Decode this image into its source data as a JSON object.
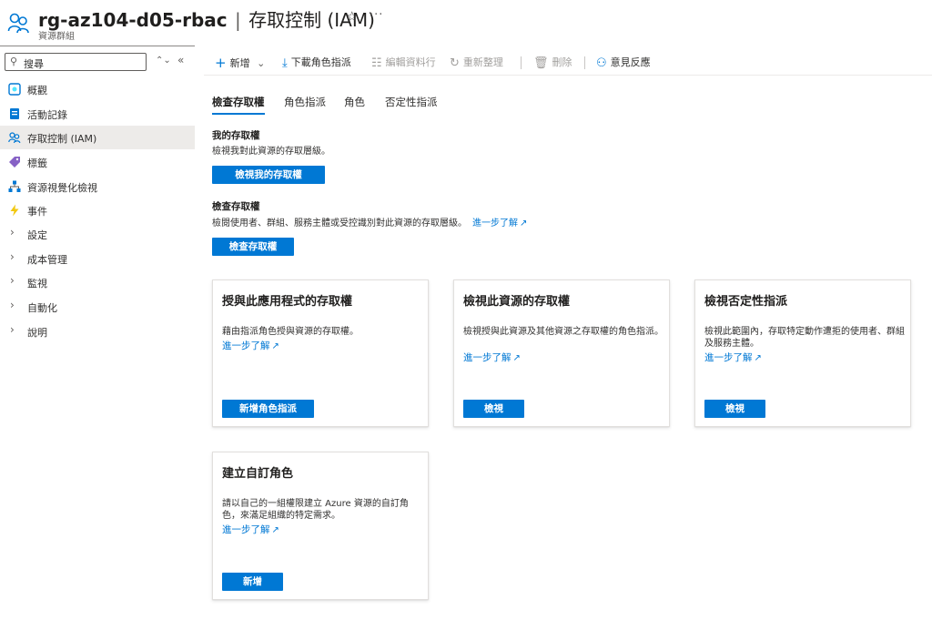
{
  "header": {
    "resource_name": "rg-az104-d05-rbac",
    "separator": "|",
    "blade_title": "存取控制 (IAM)",
    "subtitle": "資源群組",
    "favorite_icon": "star-outline-icon",
    "more_label": "···"
  },
  "sidebar": {
    "search_placeholder": "搜尋",
    "updown_label": "⌃⌄",
    "collapse_label": "«",
    "items": [
      {
        "label": "概觀",
        "icon": "overview-icon"
      },
      {
        "label": "活動記錄",
        "icon": "activity-log-icon"
      },
      {
        "label": "存取控制 (IAM)",
        "icon": "iam-people-icon",
        "selected": true
      },
      {
        "label": "標籤",
        "icon": "tag-icon"
      },
      {
        "label": "資源視覺化檢視",
        "icon": "resource-visualizer-icon"
      },
      {
        "label": "事件",
        "icon": "lightning-icon"
      },
      {
        "label": "設定",
        "expandable": true
      },
      {
        "label": "成本管理",
        "expandable": true
      },
      {
        "label": "監視",
        "expandable": true
      },
      {
        "label": "自動化",
        "expandable": true
      },
      {
        "label": "說明",
        "expandable": true
      }
    ]
  },
  "toolbar": {
    "add": "新增",
    "download": "下載角色指派",
    "edit_columns": "編輯資料行",
    "refresh": "重新整理",
    "delete": "刪除",
    "feedback": "意見反應"
  },
  "tabs": [
    "檢查存取權",
    "角色指派",
    "角色",
    "否定性指派"
  ],
  "my_access": {
    "title": "我的存取權",
    "desc": "檢視我對此資源的存取層級。",
    "button": "檢視我的存取權"
  },
  "check_access": {
    "title": "檢查存取權",
    "desc": "檢閱使用者、群組、服務主體或受控識別對此資源的存取層級。",
    "link": "進一步了解",
    "button": "檢查存取權"
  },
  "cards": [
    {
      "title": "授與此應用程式的存取權",
      "desc": "藉由指派角色授與資源的存取權。",
      "link": "進一步了解",
      "button": "新增角色指派"
    },
    {
      "title": "檢視此資源的存取權",
      "desc": "檢視授與此資源及其他資源之存取權的角色指派。",
      "link": "進一步了解",
      "button": "檢視"
    },
    {
      "title": "檢視否定性指派",
      "desc": "檢視此範圍內，存取特定動作遭拒的使用者、群組及服務主體。",
      "link": "進一步了解",
      "button": "檢視"
    },
    {
      "title": "建立自訂角色",
      "desc": "請以自己的一組權限建立 Azure 資源的自訂角色，來滿足組織的特定需求。",
      "link": "進一步了解",
      "button": "新增"
    }
  ],
  "colors": {
    "accent": "#0078d4",
    "selected_bg": "#edebe9"
  }
}
